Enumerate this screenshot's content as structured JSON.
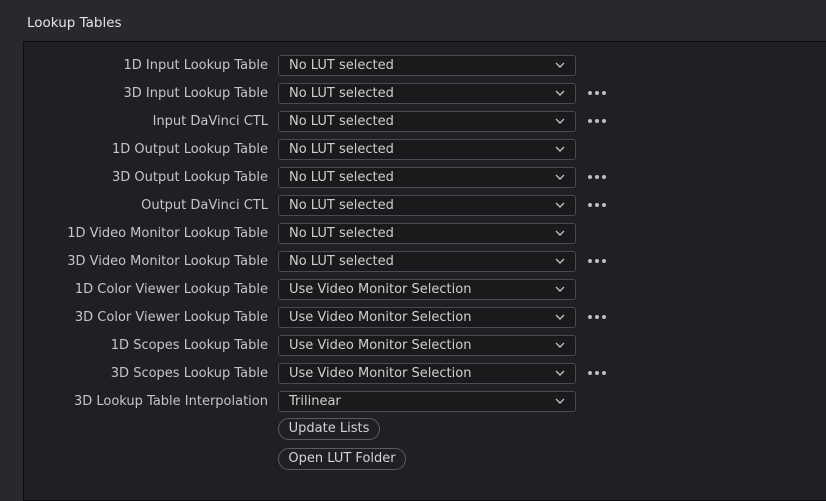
{
  "section": {
    "title": "Lookup Tables"
  },
  "rows": [
    {
      "label": "1D Input Lookup Table",
      "value": "No LUT selected",
      "more": false
    },
    {
      "label": "3D Input Lookup Table",
      "value": "No LUT selected",
      "more": true
    },
    {
      "label": "Input DaVinci CTL",
      "value": "No LUT selected",
      "more": true
    },
    {
      "label": "1D Output Lookup Table",
      "value": "No LUT selected",
      "more": false
    },
    {
      "label": "3D Output Lookup Table",
      "value": "No LUT selected",
      "more": true
    },
    {
      "label": "Output DaVinci CTL",
      "value": "No LUT selected",
      "more": true
    },
    {
      "label": "1D Video Monitor Lookup Table",
      "value": "No LUT selected",
      "more": false
    },
    {
      "label": "3D Video Monitor Lookup Table",
      "value": "No LUT selected",
      "more": true
    },
    {
      "label": "1D Color Viewer Lookup Table",
      "value": "Use Video Monitor Selection",
      "more": false
    },
    {
      "label": "3D Color Viewer Lookup Table",
      "value": "Use Video Monitor Selection",
      "more": true
    },
    {
      "label": "1D Scopes Lookup Table",
      "value": "Use Video Monitor Selection",
      "more": false
    },
    {
      "label": "3D Scopes Lookup Table",
      "value": "Use Video Monitor Selection",
      "more": true
    },
    {
      "label": "3D Lookup Table Interpolation",
      "value": "Trilinear",
      "more": false
    }
  ],
  "buttons": {
    "update_lists": "Update Lists",
    "open_lut_folder": "Open LUT Folder"
  },
  "icons": {
    "dropdown": "chevron-down-icon",
    "more": "more-options-icon"
  },
  "colors": {
    "background": "#28282e",
    "panel": "#1f1f24",
    "field": "#1a1a1d",
    "text": "#cfcfcf"
  }
}
